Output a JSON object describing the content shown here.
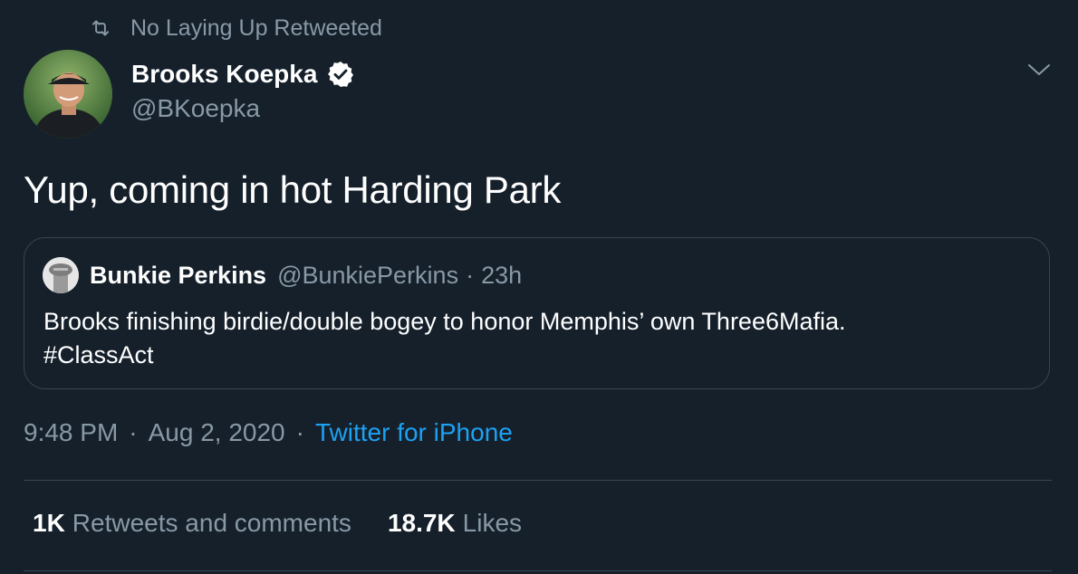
{
  "retweet_banner": {
    "text": "No Laying Up Retweeted",
    "icon": "retweet-icon"
  },
  "tweet": {
    "author": {
      "display_name": "Brooks Koepka",
      "handle": "@BKoepka",
      "verified": true
    },
    "text": "Yup, coming in hot Harding Park",
    "quoted": {
      "display_name": "Bunkie Perkins",
      "handle": "@BunkiePerkins",
      "separator": "·",
      "time": "23h",
      "text_line1": "Brooks finishing birdie/double bogey to honor Memphis’ own Three6Mafia.",
      "text_line2": "#ClassAct"
    },
    "meta": {
      "time": "9:48 PM",
      "separator": "·",
      "date": "Aug 2, 2020",
      "source": "Twitter for iPhone"
    },
    "stats": {
      "retweets_count": "1K",
      "retweets_label": "Retweets and comments",
      "likes_count": "18.7K",
      "likes_label": "Likes"
    }
  },
  "colors": {
    "background": "#15202b",
    "secondary_text": "#8899a6",
    "link": "#1da1f2",
    "border": "#38444d"
  }
}
